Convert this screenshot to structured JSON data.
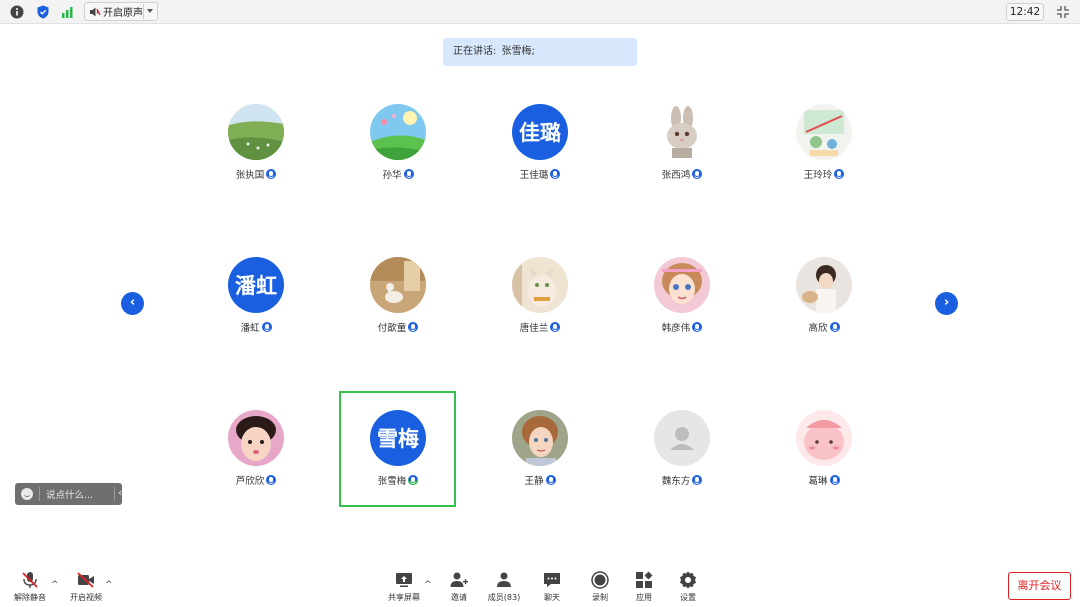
{
  "topbar": {
    "audio_label": "开启原声",
    "time": "12:42"
  },
  "speaking": {
    "label": "正在讲话:",
    "name": "张雪梅;"
  },
  "participants": [
    {
      "name": "张执国",
      "avatar_type": "photo",
      "photo": "grassland"
    },
    {
      "name": "孙华",
      "avatar_type": "photo",
      "photo": "cartoon-sky"
    },
    {
      "name": "王佳璐",
      "avatar_type": "text",
      "avatar_text": "佳璐"
    },
    {
      "name": "张西鸿",
      "avatar_type": "photo",
      "photo": "bunny"
    },
    {
      "name": "王玲玲",
      "avatar_type": "photo",
      "photo": "cartoon-room"
    },
    {
      "name": "潘虹",
      "avatar_type": "text",
      "avatar_text": "潘虹"
    },
    {
      "name": "付歆童",
      "avatar_type": "photo",
      "photo": "duck-room"
    },
    {
      "name": "唐佳兰",
      "avatar_type": "photo",
      "photo": "cat"
    },
    {
      "name": "韩彦伟",
      "avatar_type": "photo",
      "photo": "cartoon-girl"
    },
    {
      "name": "高欣",
      "avatar_type": "photo",
      "photo": "coffee"
    },
    {
      "name": "芦欣欣",
      "avatar_type": "photo",
      "photo": "baby"
    },
    {
      "name": "张雪梅",
      "avatar_type": "text",
      "avatar_text": "雪梅",
      "speaking": true
    },
    {
      "name": "王静",
      "avatar_type": "photo",
      "photo": "girl"
    },
    {
      "name": "魏东方",
      "avatar_type": "photo",
      "photo": "default-user"
    },
    {
      "name": "葛琳",
      "avatar_type": "photo",
      "photo": "pink-cartoon"
    }
  ],
  "chat": {
    "placeholder": "说点什么..."
  },
  "toolbar": {
    "unmute": "解除静音",
    "start_video": "开启视频",
    "share_screen": "共享屏幕",
    "invite": "邀请",
    "members": "成员(83)",
    "chat": "聊天",
    "record": "录制",
    "apps": "应用",
    "settings": "设置",
    "leave": "离开会议"
  },
  "colors": {
    "accent": "#1a5fe0",
    "speaking_border": "#35c04f",
    "leave": "#e02020",
    "banner": "#d8e8fc"
  }
}
